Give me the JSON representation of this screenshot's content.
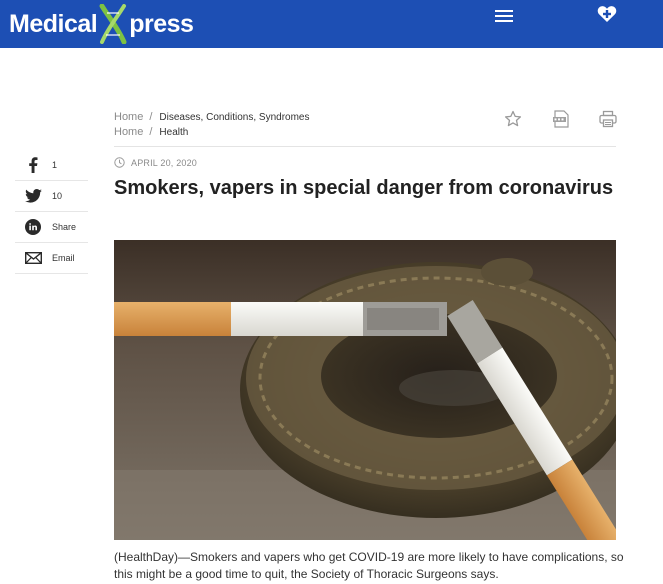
{
  "header": {
    "logo_left": "Medical",
    "logo_right": "press",
    "logo_letter": "X",
    "bg_color": "#1d4fb4",
    "menu_icon": "hamburger-menu-icon",
    "account_icon": "heart-plus-icon"
  },
  "breadcrumbs": [
    {
      "home": "Home",
      "sep": "/",
      "category": "Diseases, Conditions, Syndromes"
    },
    {
      "home": "Home",
      "sep": "/",
      "category": "Health"
    }
  ],
  "tools": [
    "favorite-star-icon",
    "pdf-icon",
    "print-icon"
  ],
  "share": [
    {
      "icon": "facebook-icon",
      "label": "1"
    },
    {
      "icon": "twitter-icon",
      "label": "10"
    },
    {
      "icon": "linkedin-icon",
      "label": "Share"
    },
    {
      "icon": "email-icon",
      "label": "Email"
    }
  ],
  "article": {
    "date": "APRIL 20, 2020",
    "title": "Smokers, vapers in special danger from coronavirus",
    "image_subject": "two cigarettes resting on a metal ashtray",
    "lead": "(HealthDay)—Smokers and vapers who get COVID-19 are more likely to have complications, so this might be a good time to quit, the Society of Thoracic Surgeons says."
  }
}
